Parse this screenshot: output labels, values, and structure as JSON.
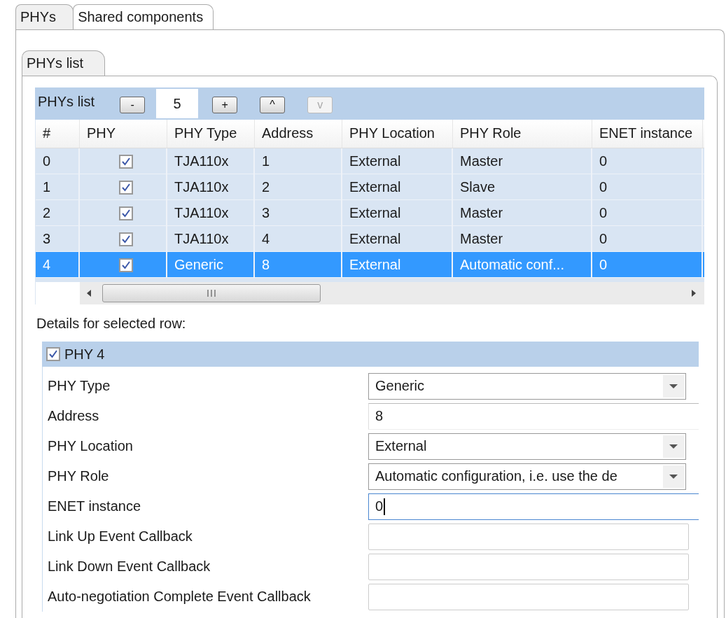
{
  "tabs": [
    {
      "label": "PHYs",
      "selected": true
    },
    {
      "label": "Shared components",
      "selected": false
    }
  ],
  "inner_tabs": [
    {
      "label": "PHYs list",
      "selected": true
    }
  ],
  "phys_list": {
    "title": "PHYs list",
    "count": "5",
    "buttons": [
      {
        "label": "-",
        "disabled": false
      },
      {
        "label": "+",
        "disabled": false
      },
      {
        "label": "^",
        "disabled": false
      },
      {
        "label": "v",
        "disabled": true
      }
    ]
  },
  "table": {
    "columns": [
      "#",
      "PHY",
      "PHY Type",
      "Address",
      "PHY Location",
      "PHY Role",
      "ENET instance"
    ],
    "rows": [
      {
        "index": "0",
        "enabled": true,
        "type": "TJA110x",
        "address": "1",
        "location": "External",
        "role": "Master",
        "enet": "0",
        "selected": false
      },
      {
        "index": "1",
        "enabled": true,
        "type": "TJA110x",
        "address": "2",
        "location": "External",
        "role": "Slave",
        "enet": "0",
        "selected": false
      },
      {
        "index": "2",
        "enabled": true,
        "type": "TJA110x",
        "address": "3",
        "location": "External",
        "role": "Master",
        "enet": "0",
        "selected": false
      },
      {
        "index": "3",
        "enabled": true,
        "type": "TJA110x",
        "address": "4",
        "location": "External",
        "role": "Master",
        "enet": "0",
        "selected": false
      },
      {
        "index": "4",
        "enabled": true,
        "type": "Generic",
        "address": "8",
        "location": "External",
        "role": "Automatic conf...",
        "enet": "0",
        "selected": true
      }
    ]
  },
  "details_label": "Details for selected row:",
  "group": {
    "title": "PHY 4",
    "checked": true,
    "fields": [
      {
        "label": "PHY Type",
        "kind": "select",
        "value": "Generic",
        "focused": false
      },
      {
        "label": "Address",
        "kind": "text",
        "value": "8",
        "focused": false
      },
      {
        "label": "PHY Location",
        "kind": "select",
        "value": "External",
        "focused": false
      },
      {
        "label": "PHY Role",
        "kind": "select",
        "value": "Automatic configuration, i.e. use the de",
        "focused": false
      },
      {
        "label": "ENET instance",
        "kind": "text",
        "value": "0",
        "focused": true
      },
      {
        "label": "Link Up Event Callback",
        "kind": "box",
        "focused": false
      },
      {
        "label": "Link Down Event Callback",
        "kind": "box",
        "focused": false
      },
      {
        "label": "Auto-negotiation Complete Event Callback",
        "kind": "box",
        "focused": false
      }
    ]
  }
}
